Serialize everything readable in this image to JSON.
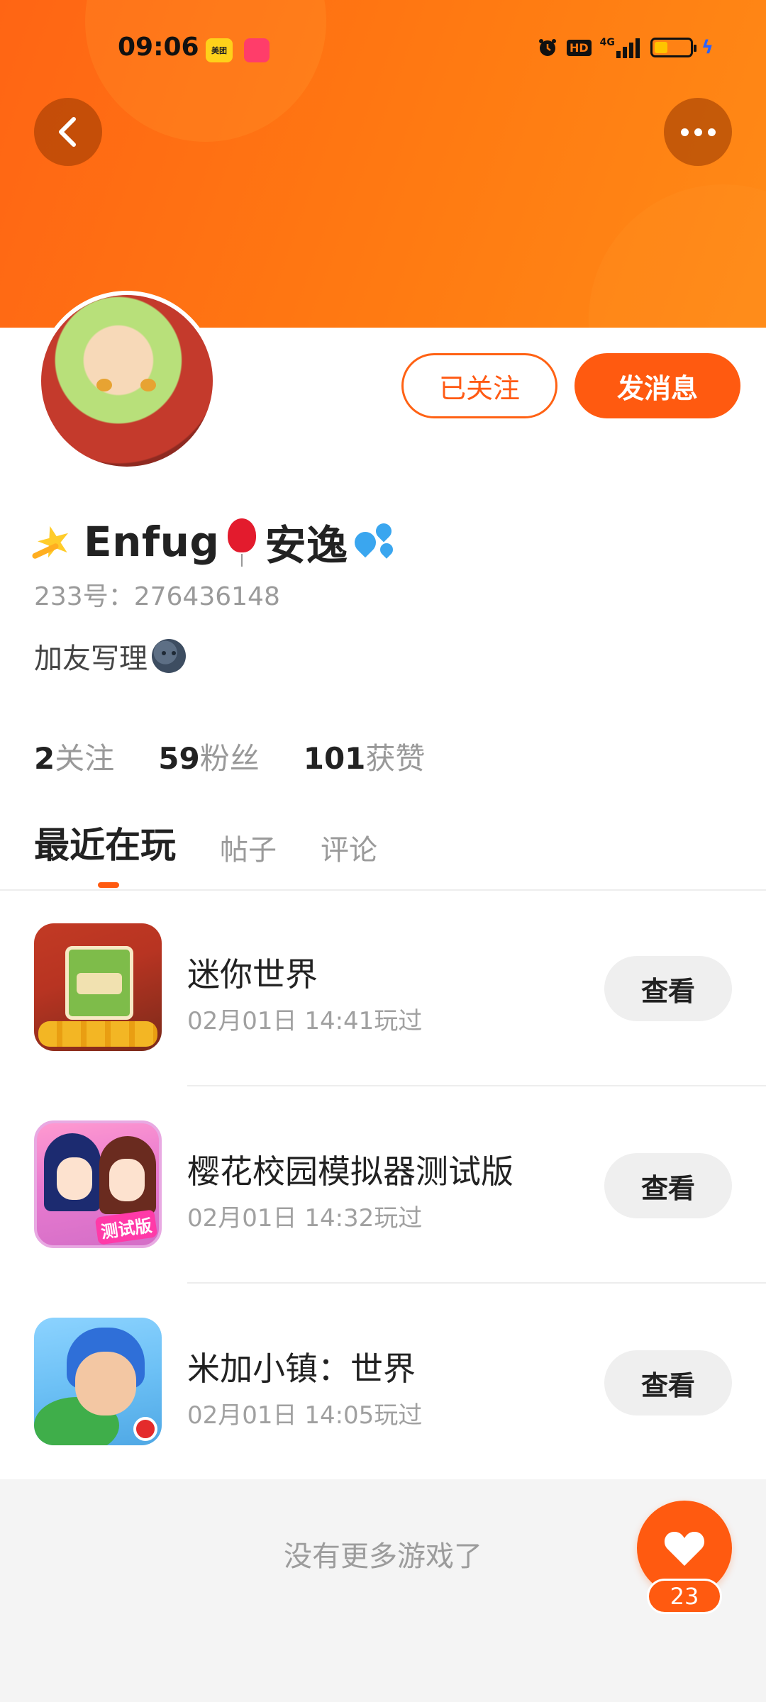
{
  "status_bar": {
    "time": "09:06",
    "meituan_label": "美团",
    "network_label": "4G",
    "hd_label": "HD"
  },
  "profile": {
    "nickname_text_1": "Enfug",
    "nickname_text_2": "安逸",
    "uid": "233号：276436148",
    "bio": "加友写理"
  },
  "actions": {
    "follow_label": "已关注",
    "message_label": "发消息"
  },
  "stats": [
    {
      "num": "2",
      "label": "关注"
    },
    {
      "num": "59",
      "label": "粉丝"
    },
    {
      "num": "101",
      "label": "获赞"
    }
  ],
  "tabs": [
    "最近在玩",
    "帖子",
    "评论"
  ],
  "games": [
    {
      "title": "迷你世界",
      "time": "02月01日 14:41玩过",
      "button": "查看"
    },
    {
      "title": "樱花校园模拟器测试版",
      "time": "02月01日 14:32玩过",
      "button": "查看",
      "badge": "测试版"
    },
    {
      "title": "米加小镇：世界",
      "time": "02月01日 14:05玩过",
      "button": "查看"
    }
  ],
  "footer": {
    "no_more": "没有更多游戏了"
  },
  "like": {
    "count": "23"
  },
  "colors": {
    "accent": "#ff5a10",
    "header_start": "#ff6514",
    "header_end": "#ff8a16"
  },
  "icons": [
    "back-icon",
    "more-icon",
    "alarm-icon",
    "signal-icon",
    "battery-icon",
    "charging-icon",
    "heart-icon"
  ]
}
